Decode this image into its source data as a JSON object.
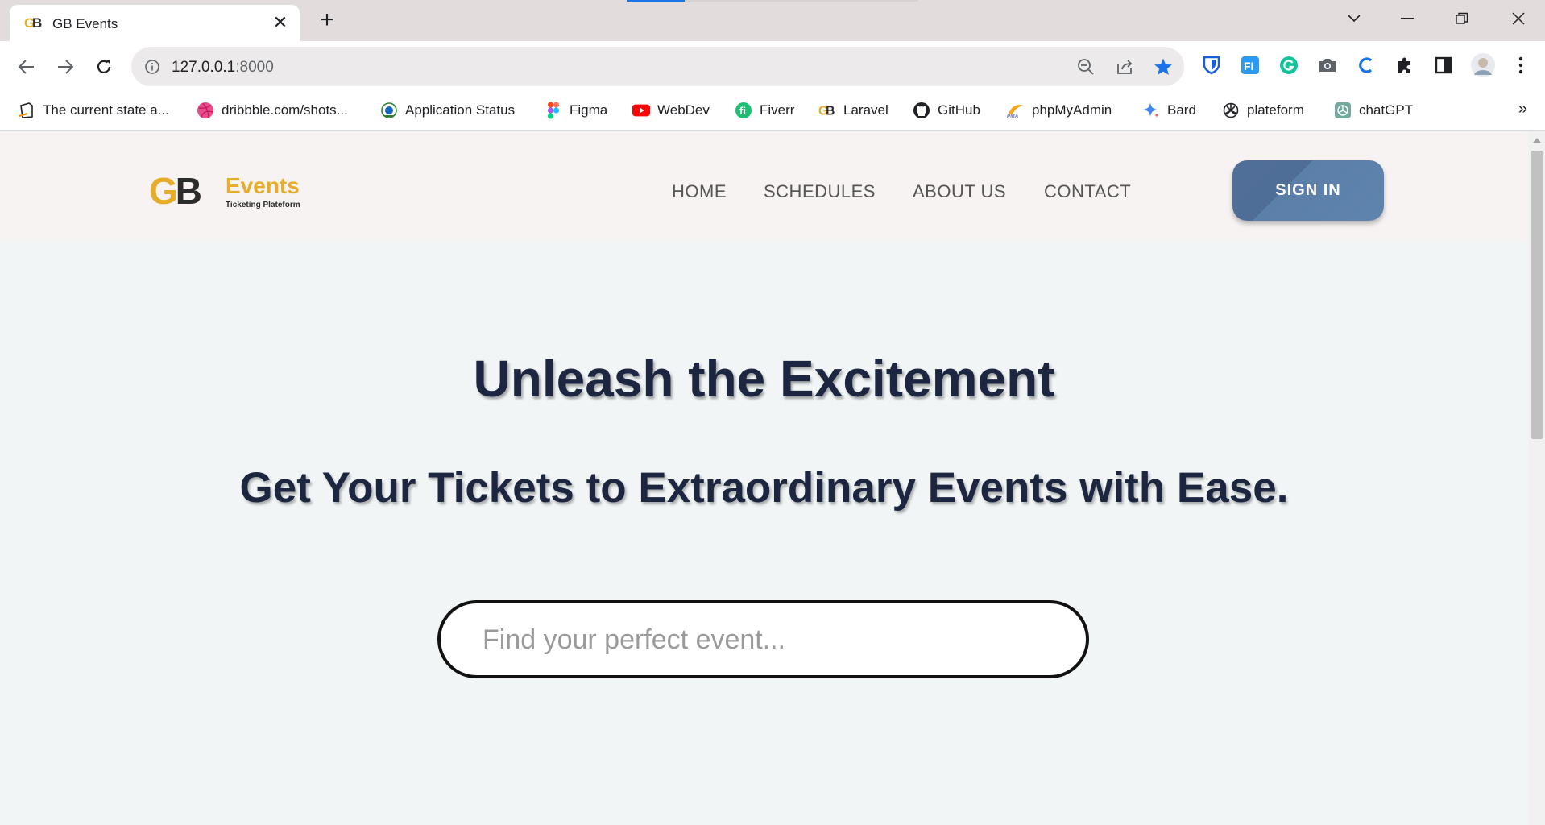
{
  "browser": {
    "tab_title": "GB Events",
    "url_host": "127.0.0.1",
    "url_port": ":8000",
    "bookmarks": [
      {
        "label": "The current state a...",
        "icon": "notion-icon"
      },
      {
        "label": "dribbble.com/shots...",
        "icon": "dribbble-icon"
      },
      {
        "label": "Application Status",
        "icon": "application-status-icon"
      },
      {
        "label": "Figma",
        "icon": "figma-icon"
      },
      {
        "label": "WebDev",
        "icon": "youtube-icon"
      },
      {
        "label": "Fiverr",
        "icon": "fiverr-icon"
      },
      {
        "label": "Laravel",
        "icon": "gb-logo-icon"
      },
      {
        "label": "GitHub",
        "icon": "github-icon"
      },
      {
        "label": "phpMyAdmin",
        "icon": "phpmyadmin-icon"
      },
      {
        "label": "Bard",
        "icon": "bard-icon"
      },
      {
        "label": "plateform",
        "icon": "openai-icon"
      },
      {
        "label": "chatGPT",
        "icon": "chatgpt-icon"
      }
    ],
    "bookmarks_more": "»"
  },
  "site": {
    "logo": {
      "gb": "GB",
      "events": "Events",
      "tagline": "Ticketing Plateform"
    },
    "nav": {
      "home": "HOME",
      "schedules": "SCHEDULES",
      "about": "ABOUT US",
      "contact": "CONTACT"
    },
    "signin_label": "SIGN IN",
    "hero": {
      "title": "Unleash the Excitement",
      "subtitle": "Get Your Tickets to Extraordinary Events with Ease."
    },
    "search": {
      "placeholder": "Find your perfect event..."
    }
  },
  "colors": {
    "accent": "#e7ad2a",
    "signin_button": "#5b7fa8",
    "heading": "#1d2640"
  }
}
